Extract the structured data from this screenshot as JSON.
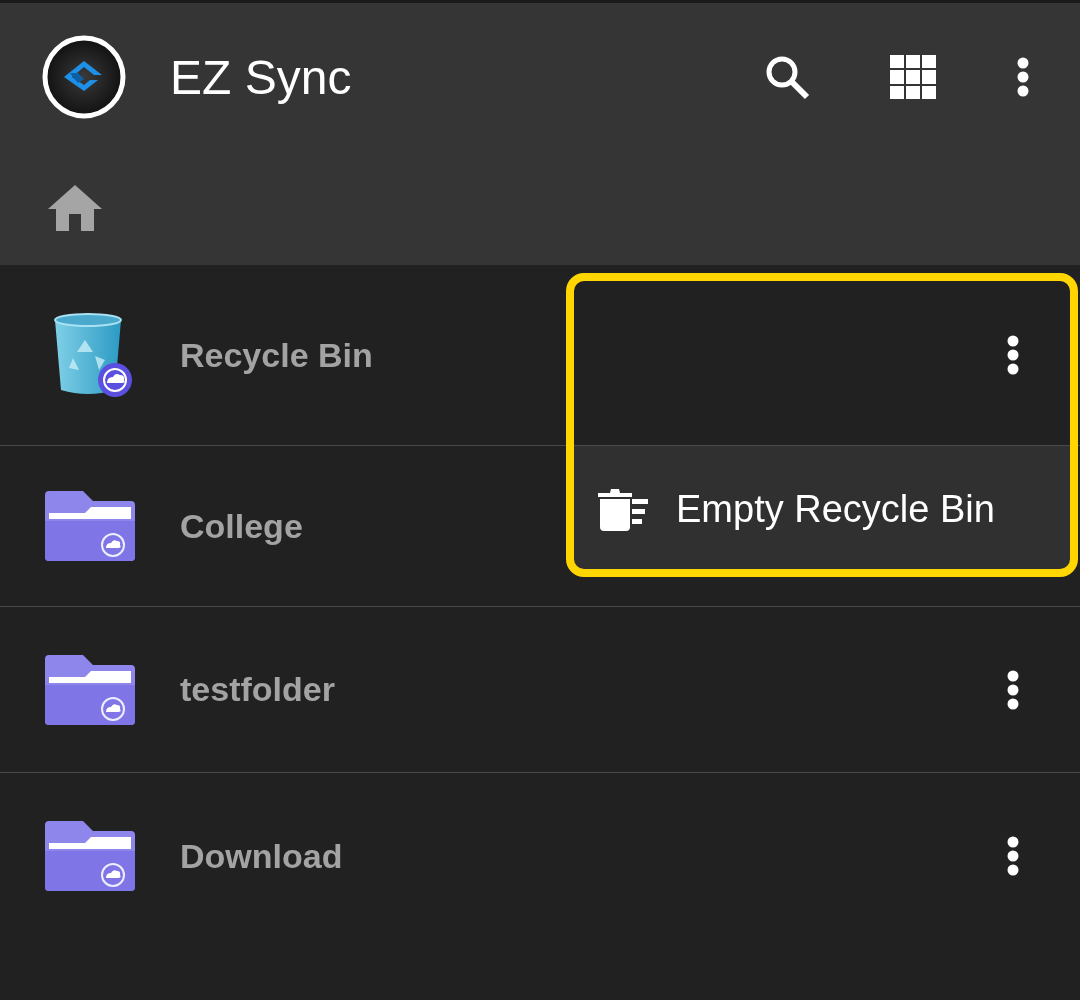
{
  "app_bar": {
    "title": "EZ Sync"
  },
  "files": [
    {
      "name": "Recycle Bin",
      "kind": "recycle_bin",
      "more_button": true
    },
    {
      "name": "College",
      "kind": "folder",
      "more_button": false
    },
    {
      "name": "testfolder",
      "kind": "folder",
      "more_button": true
    },
    {
      "name": "Download",
      "kind": "folder",
      "more_button": true
    }
  ],
  "popup_menu": {
    "items": [
      {
        "label": "Empty Recycle Bin"
      }
    ]
  },
  "highlight": {
    "shown": true
  }
}
